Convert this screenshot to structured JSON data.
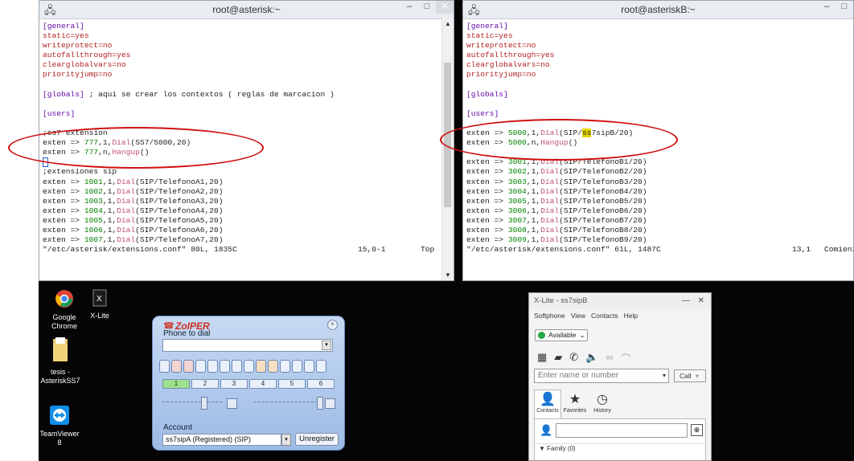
{
  "winA": {
    "title": "root@asterisk:~",
    "lines": [
      [
        {
          "t": "[general]",
          "c": "k"
        }
      ],
      [
        {
          "t": "static=yes",
          "c": "s"
        }
      ],
      [
        {
          "t": "writeprotect=no",
          "c": "s"
        }
      ],
      [
        {
          "t": "autofallthrough=yes",
          "c": "s"
        }
      ],
      [
        {
          "t": "clearglobalvars=no",
          "c": "s"
        }
      ],
      [
        {
          "t": "priorityjump=no",
          "c": "s"
        }
      ],
      [
        {
          "t": "",
          "c": ""
        }
      ],
      [
        {
          "t": "[globals]",
          "c": "k"
        },
        {
          "t": " ; aqui se crear los contextos ( reglas de marcacion )",
          "c": ""
        }
      ],
      [
        {
          "t": "",
          "c": ""
        }
      ],
      [
        {
          "t": "[users]",
          "c": "k"
        }
      ],
      [
        {
          "t": "",
          "c": ""
        }
      ],
      [
        {
          "t": ";ss7 extension",
          "c": ""
        }
      ],
      [
        {
          "t": "exten => ",
          "c": ""
        },
        {
          "t": "777",
          "c": "g"
        },
        {
          "t": ",1,",
          "c": ""
        },
        {
          "t": "Dial",
          "c": "f"
        },
        {
          "t": "(SS7/5000,20)",
          "c": ""
        }
      ],
      [
        {
          "t": "exten => ",
          "c": ""
        },
        {
          "t": "777",
          "c": "g"
        },
        {
          "t": ",n,",
          "c": ""
        },
        {
          "t": "Hangup",
          "c": "f"
        },
        {
          "t": "()",
          "c": ""
        }
      ],
      [
        {
          "t": "",
          "c": "cursor"
        }
      ],
      [
        {
          "t": ";extensiones sip",
          "c": ""
        }
      ],
      [
        {
          "t": "exten => ",
          "c": ""
        },
        {
          "t": "1001",
          "c": "g"
        },
        {
          "t": ",1,",
          "c": ""
        },
        {
          "t": "Dial",
          "c": "f"
        },
        {
          "t": "(SIP/TelefonoA1,20)",
          "c": ""
        }
      ],
      [
        {
          "t": "exten => ",
          "c": ""
        },
        {
          "t": "1002",
          "c": "g"
        },
        {
          "t": ",1,",
          "c": ""
        },
        {
          "t": "Dial",
          "c": "f"
        },
        {
          "t": "(SIP/TelefonoA2,20)",
          "c": ""
        }
      ],
      [
        {
          "t": "exten => ",
          "c": ""
        },
        {
          "t": "1003",
          "c": "g"
        },
        {
          "t": ",1,",
          "c": ""
        },
        {
          "t": "Dial",
          "c": "f"
        },
        {
          "t": "(SIP/TelefonoA3,20)",
          "c": ""
        }
      ],
      [
        {
          "t": "exten => ",
          "c": ""
        },
        {
          "t": "1004",
          "c": "g"
        },
        {
          "t": ",1,",
          "c": ""
        },
        {
          "t": "Dial",
          "c": "f"
        },
        {
          "t": "(SIP/TelefonoA4,20)",
          "c": ""
        }
      ],
      [
        {
          "t": "exten => ",
          "c": ""
        },
        {
          "t": "1005",
          "c": "g"
        },
        {
          "t": ",1,",
          "c": ""
        },
        {
          "t": "Dial",
          "c": "f"
        },
        {
          "t": "(SIP/TelefonoA5,20)",
          "c": ""
        }
      ],
      [
        {
          "t": "exten => ",
          "c": ""
        },
        {
          "t": "1006",
          "c": "g"
        },
        {
          "t": ",1,",
          "c": ""
        },
        {
          "t": "Dial",
          "c": "f"
        },
        {
          "t": "(SIP/TelefonoA6,20)",
          "c": ""
        }
      ],
      [
        {
          "t": "exten => ",
          "c": ""
        },
        {
          "t": "1007",
          "c": "g"
        },
        {
          "t": ",1,",
          "c": ""
        },
        {
          "t": "Dial",
          "c": "f"
        },
        {
          "t": "(SIP/TelefonoA7,20)",
          "c": ""
        }
      ]
    ],
    "status_file": "\"/etc/asterisk/extensions.conf\" 80L, 1835C",
    "status_pos": "15,0-1",
    "status_view": "Top"
  },
  "winB": {
    "title": "root@asteriskB:~",
    "lines": [
      [
        {
          "t": "[general]",
          "c": "k"
        }
      ],
      [
        {
          "t": "static=yes",
          "c": "s"
        }
      ],
      [
        {
          "t": "writeprotect=no",
          "c": "s"
        }
      ],
      [
        {
          "t": "autofallthrough=yes",
          "c": "s"
        }
      ],
      [
        {
          "t": "clearglobalvars=no",
          "c": "s"
        }
      ],
      [
        {
          "t": "priorityjump=no",
          "c": "s"
        }
      ],
      [
        {
          "t": "",
          "c": ""
        }
      ],
      [
        {
          "t": "[globals]",
          "c": "k"
        }
      ],
      [
        {
          "t": "",
          "c": ""
        }
      ],
      [
        {
          "t": "[users]",
          "c": "k"
        }
      ],
      [
        {
          "t": "",
          "c": ""
        }
      ],
      [
        {
          "t": "exten => ",
          "c": ""
        },
        {
          "t": "5000",
          "c": "g"
        },
        {
          "t": ",1,",
          "c": ""
        },
        {
          "t": "Dial",
          "c": "f"
        },
        {
          "t": "(SIP/",
          "c": ""
        },
        {
          "t": "ss",
          "c": "hl"
        },
        {
          "t": "7sipB/20)",
          "c": ""
        }
      ],
      [
        {
          "t": "exten => ",
          "c": ""
        },
        {
          "t": "5000",
          "c": "g"
        },
        {
          "t": ",n,",
          "c": ""
        },
        {
          "t": "Hangup",
          "c": "f"
        },
        {
          "t": "()",
          "c": ""
        }
      ],
      [
        {
          "t": "",
          "c": ""
        }
      ],
      [
        {
          "t": "exten => ",
          "c": ""
        },
        {
          "t": "3001",
          "c": "g"
        },
        {
          "t": ",1,",
          "c": ""
        },
        {
          "t": "Dial",
          "c": "f"
        },
        {
          "t": "(SIP/TelefonoB1/20)",
          "c": ""
        }
      ],
      [
        {
          "t": "exten => ",
          "c": ""
        },
        {
          "t": "3002",
          "c": "g"
        },
        {
          "t": ",1,",
          "c": ""
        },
        {
          "t": "Dial",
          "c": "f"
        },
        {
          "t": "(SIP/TelefonoB2/20)",
          "c": ""
        }
      ],
      [
        {
          "t": "exten => ",
          "c": ""
        },
        {
          "t": "3003",
          "c": "g"
        },
        {
          "t": ",1,",
          "c": ""
        },
        {
          "t": "Dial",
          "c": "f"
        },
        {
          "t": "(SIP/TelefonoB3/20)",
          "c": ""
        }
      ],
      [
        {
          "t": "exten => ",
          "c": ""
        },
        {
          "t": "3004",
          "c": "g"
        },
        {
          "t": ",1,",
          "c": ""
        },
        {
          "t": "Dial",
          "c": "f"
        },
        {
          "t": "(SIP/TelefonoB4/20)",
          "c": ""
        }
      ],
      [
        {
          "t": "exten => ",
          "c": ""
        },
        {
          "t": "3005",
          "c": "g"
        },
        {
          "t": ",1,",
          "c": ""
        },
        {
          "t": "Dial",
          "c": "f"
        },
        {
          "t": "(SIP/TelefonoB5/20)",
          "c": ""
        }
      ],
      [
        {
          "t": "exten => ",
          "c": ""
        },
        {
          "t": "3006",
          "c": "g"
        },
        {
          "t": ",1,",
          "c": ""
        },
        {
          "t": "Dial",
          "c": "f"
        },
        {
          "t": "(SIP/TelefonoB6/20)",
          "c": ""
        }
      ],
      [
        {
          "t": "exten => ",
          "c": ""
        },
        {
          "t": "3007",
          "c": "g"
        },
        {
          "t": ",1,",
          "c": ""
        },
        {
          "t": "Dial",
          "c": "f"
        },
        {
          "t": "(SIP/TelefonoB7/20)",
          "c": ""
        }
      ],
      [
        {
          "t": "exten => ",
          "c": ""
        },
        {
          "t": "3008",
          "c": "g"
        },
        {
          "t": ",1,",
          "c": ""
        },
        {
          "t": "Dial",
          "c": "f"
        },
        {
          "t": "(SIP/TelefonoB8/20)",
          "c": ""
        }
      ],
      [
        {
          "t": "exten => ",
          "c": ""
        },
        {
          "t": "3009",
          "c": "g"
        },
        {
          "t": ",1,",
          "c": ""
        },
        {
          "t": "Dial",
          "c": "f"
        },
        {
          "t": "(SIP/TelefonoB9/20)",
          "c": ""
        }
      ]
    ],
    "status_file": "\"/etc/asterisk/extensions.conf\" 61L, 1487C",
    "status_pos": "13,1",
    "status_view": "Comienzo"
  },
  "desktop_icons": [
    {
      "label": "Google\nChrome",
      "icon": "chrome-icon"
    },
    {
      "label": "X-Lite",
      "icon": "xlite-icon"
    },
    {
      "label": "tesis -\nAsteriskSS7",
      "icon": "folder-icon"
    },
    {
      "label": "TeamViewer\n8",
      "icon": "teamviewer-icon"
    }
  ],
  "zoiper": {
    "logo": "ZoIPER",
    "phone_label": "Phone to dial",
    "lines": [
      "1",
      "2",
      "3",
      "4",
      "5",
      "6"
    ],
    "account_label": "Account",
    "account_value": "ss7sipA (Registered) (SIP)",
    "unregister": "Unregister"
  },
  "xlite": {
    "title": "X-Lite - ss7sipB",
    "menu": [
      "Softphone",
      "View",
      "Contacts",
      "Help"
    ],
    "status": "Available",
    "search_placeholder": "Enter name or number",
    "call": "Call",
    "tabs": [
      "Contacts",
      "Favorites",
      "History"
    ],
    "group": "Family (0)"
  },
  "colors": {
    "annotation": "#d01010",
    "keyword": "#6a0dad",
    "setting": "#b22222",
    "number": "#008000",
    "highlight": "#e6d400"
  }
}
